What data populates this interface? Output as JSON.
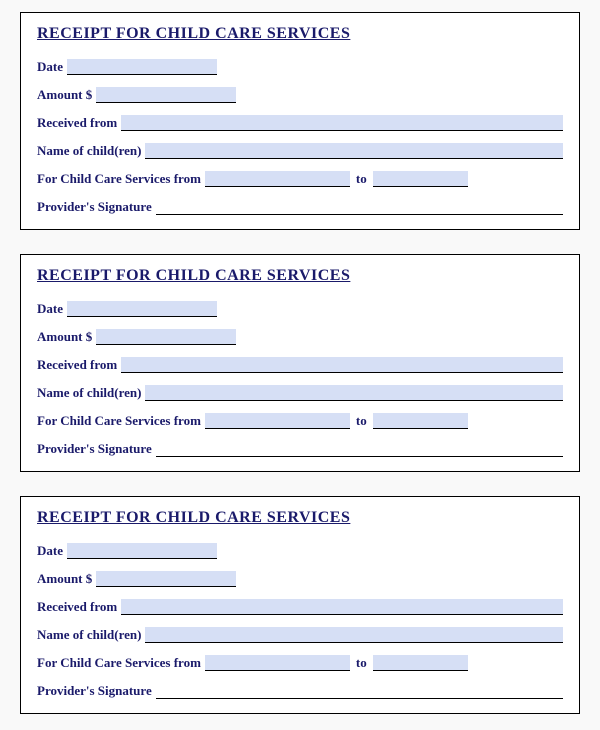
{
  "receipt": {
    "title": "RECEIPT FOR CHILD CARE SERVICES",
    "labels": {
      "date": "Date",
      "amount": "Amount $",
      "received_from": "Received from",
      "name_of_children": "Name of child(ren)",
      "services_from": "For Child Care Services from",
      "to": "to",
      "provider_signature": "Provider's Signature"
    },
    "values": {
      "date": "",
      "amount": "",
      "received_from": "",
      "name_of_children": "",
      "services_from": "",
      "services_to": "",
      "provider_signature": ""
    }
  },
  "copies": 3
}
